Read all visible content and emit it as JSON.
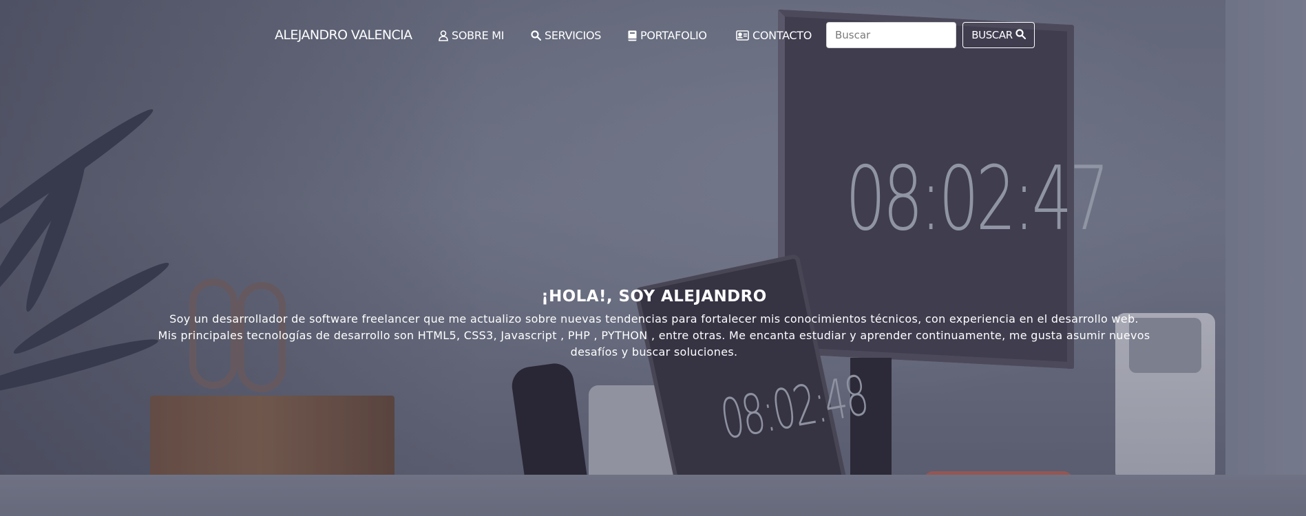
{
  "navbar": {
    "brand": "ALEJANDRO VALENCIA",
    "items": [
      {
        "label": "SOBRE MI",
        "icon": "user-icon"
      },
      {
        "label": "SERVICIOS",
        "icon": "search-icon"
      },
      {
        "label": "PORTAFOLIO",
        "icon": "book-icon"
      },
      {
        "label": "CONTACTO",
        "icon": "address-card-icon"
      }
    ],
    "search": {
      "placeholder": "Buscar",
      "value": "",
      "button_label": "BUSCAR",
      "button_icon": "search-icon"
    }
  },
  "background": {
    "clock_monitor": "08:02:47",
    "clock_laptop": "08:02:48"
  },
  "hero": {
    "title": "¡HOLA!, SOY ALEJANDRO",
    "line1": "Soy un desarrollador de software freelancer que me actualizo sobre nuevas tendencias para fortalecer mis conocimientos técnicos, con experiencia en el desarrollo web.",
    "line2": "Mis principales tecnologías de desarrollo son HTML5, CSS3, Javascript , PHP , PYTHON , entre otras. Me encanta estudiar y aprender continuamente, me gusta asumir nuevos desafíos y buscar soluciones."
  },
  "colors": {
    "text": "#ffffff",
    "overlay": "#4a4860",
    "input_bg": "#ffffff"
  }
}
